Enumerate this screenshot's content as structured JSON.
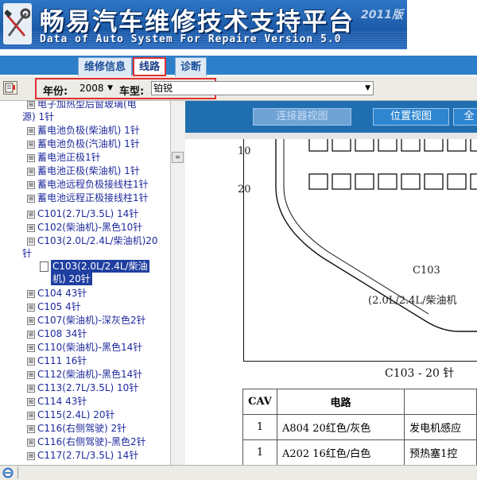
{
  "banner": {
    "title": "畅易汽车维修技术支持平台",
    "edition": "2011版",
    "subtitle": "Data of Auto System For Repaire Version 5.0"
  },
  "tabs": [
    {
      "label": "维修信息"
    },
    {
      "label": "线路"
    },
    {
      "label": "诊断"
    }
  ],
  "active_tab": "线路",
  "toolbar": {
    "year_label": "年份:",
    "year_value": "2008",
    "model_label": "车型:",
    "model_value": "铂锐"
  },
  "tree": {
    "items": [
      {
        "label": "电子加热型后窗玻璃(电",
        "expand": "⊞"
      },
      {
        "label": "源) 1针",
        "expand": ""
      },
      {
        "label": "蓄电池负极(柴油机) 1针",
        "expand": "⊞"
      },
      {
        "label": "蓄电池负极(汽油机) 1针",
        "expand": "⊞"
      },
      {
        "label": "蓄电池正极1针",
        "expand": "⊞"
      },
      {
        "label": "蓄电池正极(柴油机) 1针",
        "expand": "⊞"
      },
      {
        "label": "蓄电池远程负极接线柱1针",
        "expand": "⊞"
      },
      {
        "label": "蓄电池远程正极接线柱1针",
        "expand": "⊞"
      },
      {
        "label": "C101(2.7L/3.5L) 14针",
        "expand": "⊞"
      },
      {
        "label": "C102(柴油机)-黑色10针",
        "expand": "⊞"
      },
      {
        "label": "C103(2.0L/2.4L/柴油机)20",
        "expand": "⊟"
      },
      {
        "label": "针",
        "expand": ""
      }
    ],
    "selected_label_line1": "C103(2.0L/2.4L/柴油",
    "selected_label_line2": "机) 20针",
    "items_after": [
      {
        "label": "C104 43针",
        "expand": "⊞"
      },
      {
        "label": "C105 4针",
        "expand": "⊞"
      },
      {
        "label": "C107(柴油机)-深灰色2针",
        "expand": "⊞"
      },
      {
        "label": "C108 34针",
        "expand": "⊞"
      },
      {
        "label": "C110(柴油机)-黑色14针",
        "expand": "⊞"
      },
      {
        "label": "C111 16针",
        "expand": "⊞"
      },
      {
        "label": "C112(柴油机)-黑色14针",
        "expand": "⊞"
      },
      {
        "label": "C113(2.7L/3.5L) 10针",
        "expand": "⊞"
      },
      {
        "label": "C114 43针",
        "expand": "⊞"
      },
      {
        "label": "C115(2.4L) 20针",
        "expand": "⊞"
      },
      {
        "label": "C116(右侧驾驶) 2针",
        "expand": "⊞"
      },
      {
        "label": "C116(右侧驾驶)-黑色2针",
        "expand": "⊞"
      },
      {
        "label": "C117(2.7L/3.5L) 14针",
        "expand": "⊞"
      }
    ]
  },
  "right_panel": {
    "buttons": {
      "connector_view": "连接器视图",
      "position_view": "位置视图",
      "full": "全"
    },
    "diagram": {
      "row_label_1": "10",
      "row_label_2": "20",
      "connector_name": "C103",
      "connector_desc": "(2.0L/2.4L/柴油机"
    },
    "caption": "C103 - 20 针",
    "table": {
      "headers": [
        "CAV",
        "电路",
        ""
      ],
      "rows": [
        [
          "1",
          "A804 20红色/灰色",
          "发电机感应"
        ],
        [
          "1",
          "A202 16红色/白色",
          "预热塞1控"
        ]
      ]
    }
  },
  "colors": {
    "banner_blue": "#1c5aa8",
    "tab_strip": "#2c7fc8",
    "highlight_red": "#e03030",
    "tree_text": "#1e2a9c",
    "selection": "#1f3fa0",
    "panel_header": "#1f6fb0"
  }
}
